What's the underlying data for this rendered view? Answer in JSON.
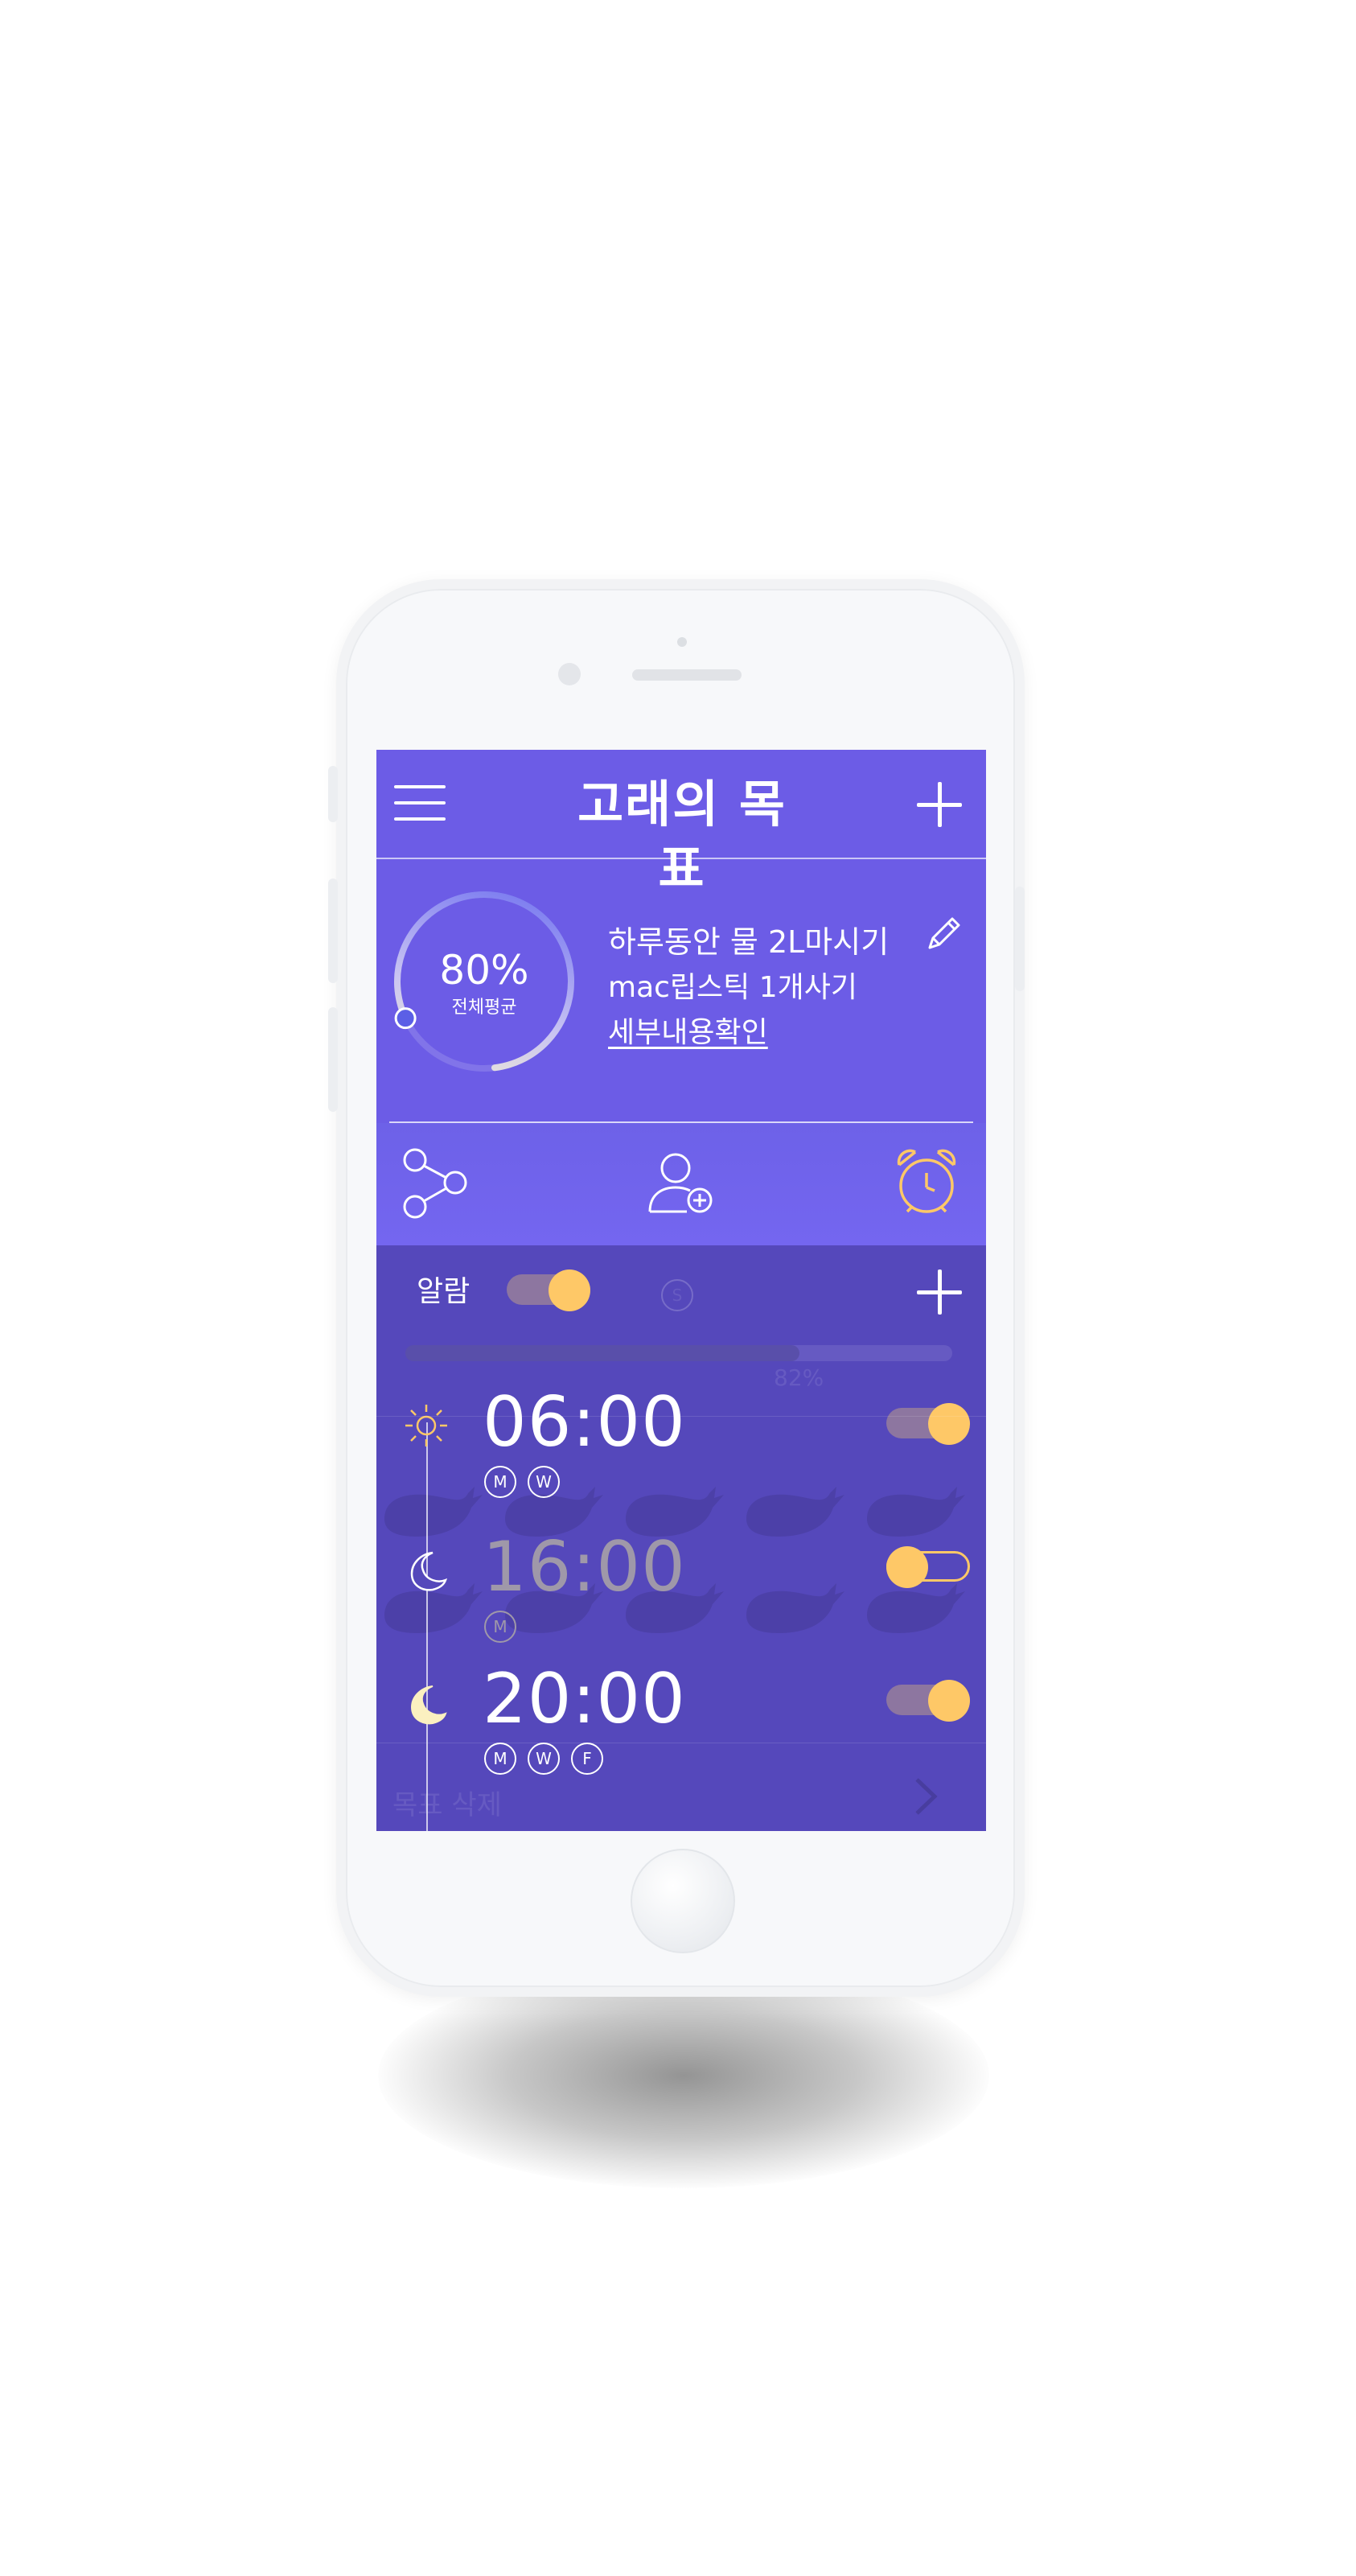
{
  "header": {
    "title": "고래의 목표"
  },
  "summary": {
    "percent": "80%",
    "percent_value": 80,
    "percent_label": "전체평균",
    "goal_1": "하루동안 물 2L마시기",
    "goal_2": "mac립스틱 1개사기",
    "detail_link": "세부내용확인"
  },
  "alarm": {
    "label": "알람",
    "master_on": true,
    "background_ghost_text": {
      "char_s": "S",
      "progress_text": "82%",
      "delete_label": "목표 삭제"
    },
    "items": [
      {
        "time": "06:00",
        "icon": "sun-icon",
        "days": [
          "M",
          "W"
        ],
        "on": true
      },
      {
        "time": "16:00",
        "icon": "crescent-moon-outline-icon",
        "days": [
          "M"
        ],
        "on": false
      },
      {
        "time": "20:00",
        "icon": "crescent-moon-filled-icon",
        "days": [
          "M",
          "W",
          "F"
        ],
        "on": true
      }
    ]
  },
  "colors": {
    "primary": "#6c5ce6",
    "panel": "#5548bb",
    "accent": "#fec867",
    "ring_gradient": [
      "#6a6cf0",
      "#f4f0d0"
    ]
  }
}
